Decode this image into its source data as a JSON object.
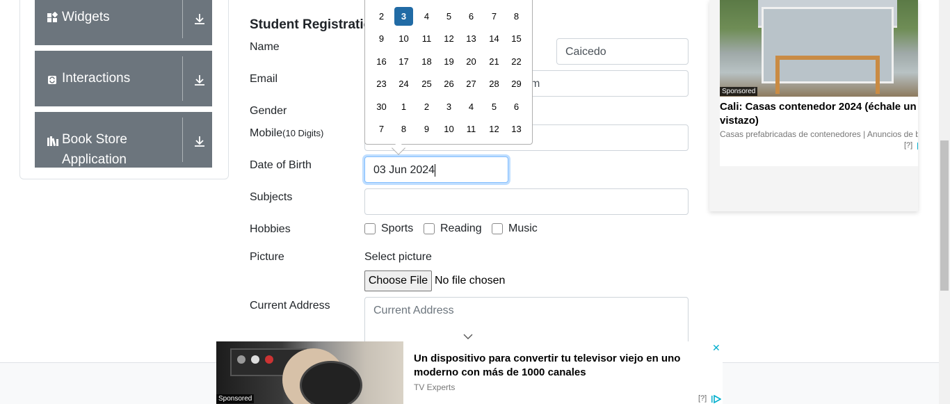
{
  "sidebar": {
    "groups": [
      {
        "label": "Widgets",
        "icon": "widgets-icon"
      },
      {
        "label": "Interactions",
        "icon": "interactions-icon"
      },
      {
        "label": "Book Store",
        "label2": "Application",
        "icon": "book-store-icon"
      }
    ]
  },
  "form": {
    "title": "Student Registration",
    "labels": {
      "name": "Name",
      "email": "Email",
      "gender": "Gender",
      "mobile": "Mobile",
      "mobile_hint": "(10 Digits)",
      "dob": "Date of Birth",
      "subjects": "Subjects",
      "hobbies": "Hobbies",
      "picture": "Picture",
      "current_address": "Current Address"
    },
    "last_name_value": "Caicedo",
    "email_value_tail": "m",
    "dob_value": "03 Jun 2024",
    "hobbies": [
      "Sports",
      "Reading",
      "Music"
    ],
    "picture_prompt": "Select picture",
    "file_button": "Choose File",
    "file_status": "No file chosen",
    "address_placeholder": "Current Address"
  },
  "datepicker": {
    "selected_day": "3",
    "weeks": [
      [
        "2",
        "3",
        "4",
        "5",
        "6",
        "7",
        "8"
      ],
      [
        "9",
        "10",
        "11",
        "12",
        "13",
        "14",
        "15"
      ],
      [
        "16",
        "17",
        "18",
        "19",
        "20",
        "21",
        "22"
      ],
      [
        "23",
        "24",
        "25",
        "26",
        "27",
        "28",
        "29"
      ],
      [
        "30",
        "1",
        "2",
        "3",
        "4",
        "5",
        "6"
      ],
      [
        "7",
        "8",
        "9",
        "10",
        "11",
        "12",
        "13"
      ]
    ]
  },
  "right_ad": {
    "sponsored": "Sponsored",
    "title": "Cali: Casas contenedor 2024 (échale un vistazo)",
    "source": "Casas prefabricadas de contenedores | Anuncios de b...",
    "help": "[?]"
  },
  "bottom_ad": {
    "sponsored": "Sponsored",
    "title": "Un dispositivo para convertir tu televisor viejo en uno moderno con más de 1000 canales",
    "source": "TV Experts",
    "help": "[?]"
  },
  "colors": {
    "sidebar_group": "#6c757d",
    "selected_day": "#216ba5",
    "focus_border": "#80bdff"
  }
}
